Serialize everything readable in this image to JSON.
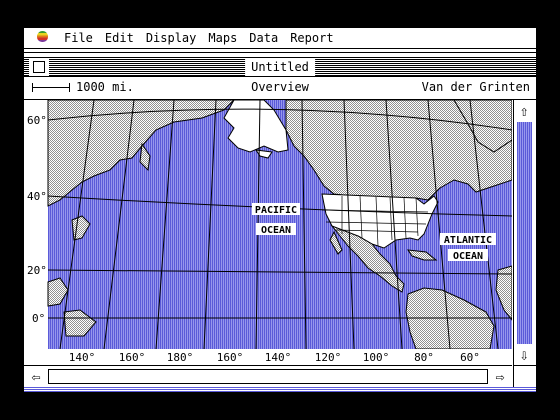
{
  "menubar": {
    "items": [
      {
        "label": "File"
      },
      {
        "label": "Edit"
      },
      {
        "label": "Display"
      },
      {
        "label": "Maps"
      },
      {
        "label": "Data"
      },
      {
        "label": "Report"
      }
    ]
  },
  "window": {
    "title": "Untitled"
  },
  "infobar": {
    "scale": "1000 mi.",
    "view": "Overview",
    "projection": "Van der Grinten"
  },
  "map": {
    "latitude_labels": [
      "60°",
      "40°",
      "20°",
      "0°"
    ],
    "longitude_labels": [
      "140°",
      "160°",
      "180°",
      "160°",
      "140°",
      "120°",
      "100°",
      "80°",
      "60°"
    ],
    "oceans": [
      {
        "line1": "PACIFIC",
        "line2": "OCEAN"
      },
      {
        "line1": "ATLANTIC",
        "line2": "OCEAN"
      }
    ],
    "colors": {
      "ocean": "#9696ec",
      "ocean_stripe": "#5a5ad8",
      "land_pattern": "#909090",
      "highlight_land": "#ffffff",
      "grid": "#000000"
    }
  },
  "scrollbars": {
    "up_icon": "⇧",
    "down_icon": "⇩",
    "left_icon": "⇦",
    "right_icon": "⇨"
  }
}
